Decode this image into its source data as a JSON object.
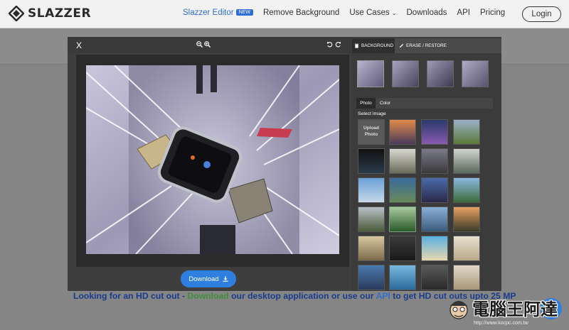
{
  "brand": {
    "name": "SLAZZER"
  },
  "nav": {
    "editor_label": "Slazzer Editor",
    "new_badge": "NEW",
    "remove_bg": "Remove Background",
    "use_cases": "Use Cases",
    "downloads": "Downloads",
    "api": "API",
    "pricing": "Pricing",
    "login": "Login"
  },
  "modal": {
    "close": "X",
    "tabs": {
      "background": "BACKGROUND",
      "erase": "ERASE / RESTORE"
    },
    "subtabs": {
      "photo": "Photo",
      "color": "Color"
    },
    "select_image": "Select Image",
    "upload_photo_line1": "Upload",
    "upload_photo_line2": "Photo",
    "download": "Download"
  },
  "promo": {
    "part1": "Looking for an HD cut out - ",
    "link_download": "Download",
    "part2": " our desktop application or use our ",
    "link_api": "API",
    "part3": " to get HD cut outs upto 25 MP"
  },
  "watermark": {
    "text": "電腦王阿達",
    "url": "http://www.kocpc.com.tw"
  },
  "colors": {
    "accent": "#2f7fe0",
    "modal_bg": "#3e3e3e",
    "nav_bg": "#f2f2f2"
  },
  "icons": [
    "zoom-out-icon",
    "zoom-in-icon",
    "undo-icon",
    "redo-icon",
    "trash-icon",
    "brush-icon",
    "download-icon",
    "caret-down-icon"
  ]
}
